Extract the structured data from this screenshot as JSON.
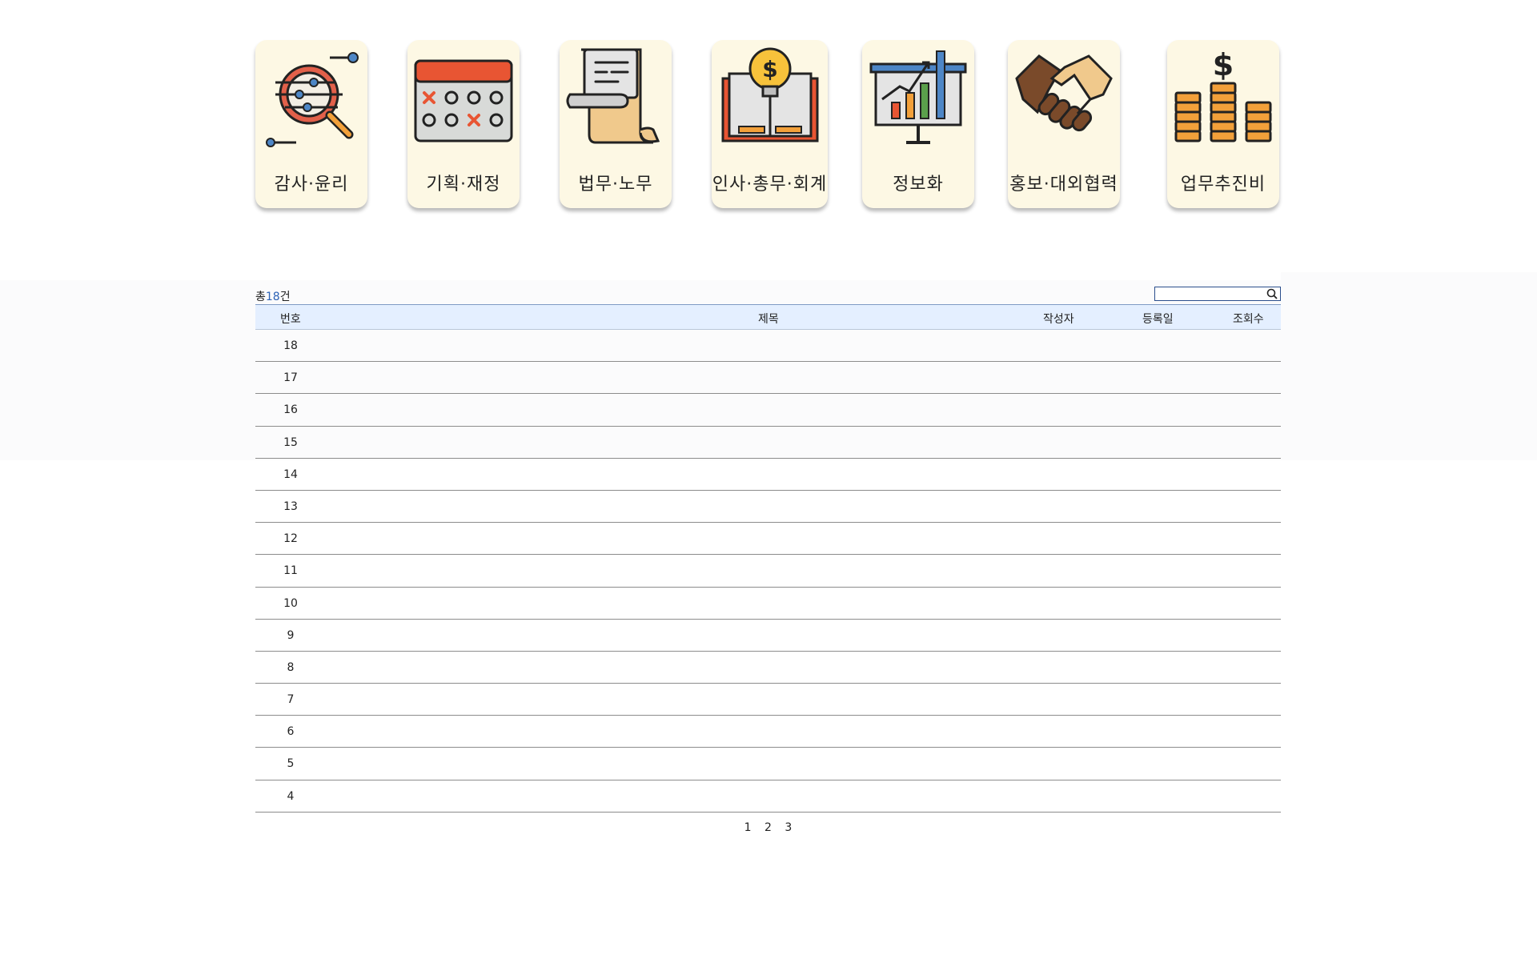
{
  "categories": [
    {
      "label": "감사·윤리",
      "icon": "audit-magnifier-icon"
    },
    {
      "label": "기획·재정",
      "icon": "planning-calendar-icon"
    },
    {
      "label": "법무·노무",
      "icon": "legal-scroll-icon"
    },
    {
      "label": "인사·총무·회계",
      "icon": "idea-book-icon"
    },
    {
      "label": "정보화",
      "icon": "presentation-chart-icon"
    },
    {
      "label": "홍보·대외협력",
      "icon": "handshake-icon"
    },
    {
      "label": "업무추진비",
      "icon": "coin-stacks-icon"
    }
  ],
  "board": {
    "count_prefix": "총",
    "count_value": "18",
    "count_suffix": "건",
    "search_placeholder": "",
    "headers": {
      "no": "번호",
      "title": "제목",
      "author": "작성자",
      "date": "등록일",
      "views": "조회수"
    },
    "rows": [
      {
        "no": "18"
      },
      {
        "no": "17"
      },
      {
        "no": "16"
      },
      {
        "no": "15"
      },
      {
        "no": "14"
      },
      {
        "no": "13"
      },
      {
        "no": "12"
      },
      {
        "no": "11"
      },
      {
        "no": "10"
      },
      {
        "no": "9"
      },
      {
        "no": "8"
      },
      {
        "no": "7"
      },
      {
        "no": "6"
      },
      {
        "no": "5"
      },
      {
        "no": "4"
      }
    ],
    "pages": [
      "1",
      "2",
      "3"
    ]
  },
  "colors": {
    "card_bg": "#fdf8e4",
    "header_bg": "#e4efff",
    "accent": "#2b62b6"
  }
}
